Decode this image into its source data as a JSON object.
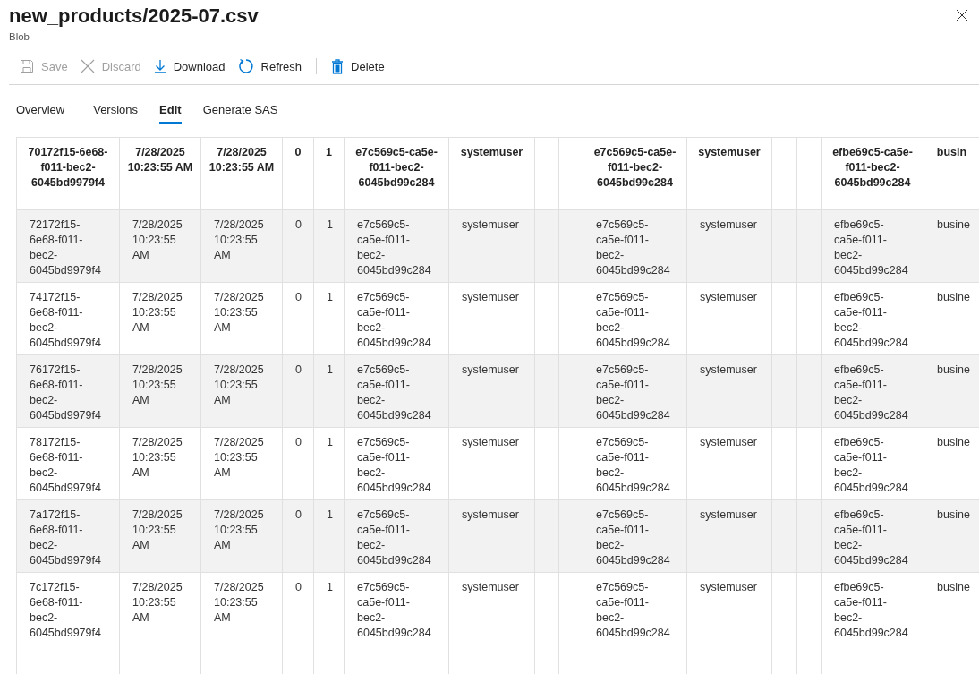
{
  "panel": {
    "title": "new_products/2025-07.csv",
    "subtitle": "Blob"
  },
  "toolbar": [
    {
      "kind": "save",
      "label": "Save",
      "disabled": true
    },
    {
      "kind": "discard",
      "label": "Discard",
      "disabled": true
    },
    {
      "kind": "download",
      "label": "Download",
      "disabled": false
    },
    {
      "kind": "refresh",
      "label": "Refresh",
      "disabled": false
    },
    {
      "kind": "separator"
    },
    {
      "kind": "delete",
      "label": "Delete",
      "disabled": false
    }
  ],
  "tabs": [
    {
      "label": "Overview",
      "selected": false
    },
    {
      "label": "Versions",
      "selected": false
    },
    {
      "label": "Edit",
      "selected": true
    },
    {
      "label": "Generate SAS",
      "selected": false
    }
  ],
  "table": {
    "columns": [
      "70172f15-6e68-f011-bec2-6045bd9979f4",
      "7/28/2025 10:23:55 AM",
      "7/28/2025 10:23:55 AM",
      "0",
      "1",
      "e7c569c5-ca5e-f011-bec2-6045bd99c284",
      "systemuser",
      null,
      null,
      "e7c569c5-ca5e-f011-bec2-6045bd99c284",
      "systemuser",
      null,
      null,
      "efbe69c5-ca5e-f011-bec2-6045bd99c284",
      "busin"
    ],
    "rows": [
      [
        "72172f15-6e68-f011-bec2-6045bd9979f4",
        "7/28/2025 10:23:55 AM",
        "7/28/2025 10:23:55 AM",
        "0",
        "1",
        "e7c569c5-ca5e-f011-bec2-6045bd99c284",
        "systemuser",
        null,
        null,
        "e7c569c5-ca5e-f011-bec2-6045bd99c284",
        "systemuser",
        null,
        null,
        "efbe69c5-ca5e-f011-bec2-6045bd99c284",
        "busine"
      ],
      [
        "74172f15-6e68-f011-bec2-6045bd9979f4",
        "7/28/2025 10:23:55 AM",
        "7/28/2025 10:23:55 AM",
        "0",
        "1",
        "e7c569c5-ca5e-f011-bec2-6045bd99c284",
        "systemuser",
        null,
        null,
        "e7c569c5-ca5e-f011-bec2-6045bd99c284",
        "systemuser",
        null,
        null,
        "efbe69c5-ca5e-f011-bec2-6045bd99c284",
        "busine"
      ],
      [
        "76172f15-6e68-f011-bec2-6045bd9979f4",
        "7/28/2025 10:23:55 AM",
        "7/28/2025 10:23:55 AM",
        "0",
        "1",
        "e7c569c5-ca5e-f011-bec2-6045bd99c284",
        "systemuser",
        null,
        null,
        "e7c569c5-ca5e-f011-bec2-6045bd99c284",
        "systemuser",
        null,
        null,
        "efbe69c5-ca5e-f011-bec2-6045bd99c284",
        "busine"
      ],
      [
        "78172f15-6e68-f011-bec2-6045bd9979f4",
        "7/28/2025 10:23:55 AM",
        "7/28/2025 10:23:55 AM",
        "0",
        "1",
        "e7c569c5-ca5e-f011-bec2-6045bd99c284",
        "systemuser",
        null,
        null,
        "e7c569c5-ca5e-f011-bec2-6045bd99c284",
        "systemuser",
        null,
        null,
        "efbe69c5-ca5e-f011-bec2-6045bd99c284",
        "busine"
      ],
      [
        "7a172f15-6e68-f011-bec2-6045bd9979f4",
        "7/28/2025 10:23:55 AM",
        "7/28/2025 10:23:55 AM",
        "0",
        "1",
        "e7c569c5-ca5e-f011-bec2-6045bd99c284",
        "systemuser",
        null,
        null,
        "e7c569c5-ca5e-f011-bec2-6045bd99c284",
        "systemuser",
        null,
        null,
        "efbe69c5-ca5e-f011-bec2-6045bd99c284",
        "busine"
      ],
      [
        "7c172f15-6e68-f011-bec2-6045bd9979f4",
        "7/28/2025 10:23:55 AM",
        "7/28/2025 10:23:55 AM",
        "0",
        "1",
        "e7c569c5-ca5e-f011-bec2-6045bd99c284",
        "systemuser",
        null,
        null,
        "e7c569c5-ca5e-f011-bec2-6045bd99c284",
        "systemuser",
        null,
        null,
        "efbe69c5-ca5e-f011-bec2-6045bd99c284",
        "busine"
      ]
    ]
  }
}
